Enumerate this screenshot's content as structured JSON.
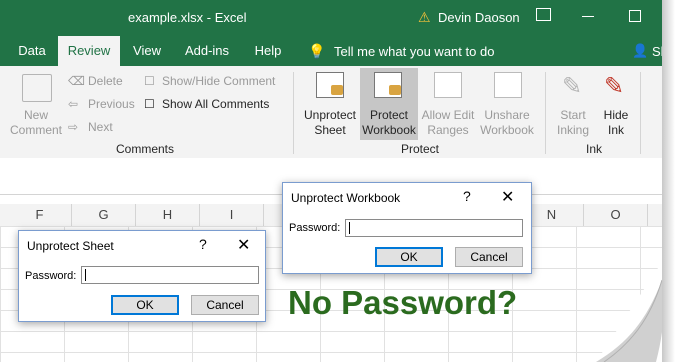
{
  "window": {
    "title": "example.xlsx  -  Excel",
    "user": "Devin Daoson",
    "colors": {
      "brand": "#217346",
      "headline": "#2b6b1f",
      "ok_border": "#0078d7"
    }
  },
  "tabs": [
    {
      "label": "Data"
    },
    {
      "label": "Review"
    },
    {
      "label": "View"
    },
    {
      "label": "Add-ins"
    },
    {
      "label": "Help"
    }
  ],
  "tell_me": "Tell me what you want to do",
  "share_label": "Sl",
  "ribbon": {
    "new_comment": {
      "line1": "New",
      "line2": "Comment"
    },
    "delete": "Delete",
    "previous": "Previous",
    "next": "Next",
    "show_hide_comment": "Show/Hide Comment",
    "show_all_comments": "Show All Comments",
    "comments_group": "Comments",
    "unprotect_sheet": {
      "line1": "Unprotect",
      "line2": "Sheet"
    },
    "protect_workbook": {
      "line1": "Protect",
      "line2": "Workbook"
    },
    "allow_edit_ranges": {
      "line1": "Allow Edit",
      "line2": "Ranges"
    },
    "unshare_workbook": {
      "line1": "Unshare",
      "line2": "Workbook"
    },
    "protect_group": "Protect",
    "start_inking": {
      "line1": "Start",
      "line2": "Inking"
    },
    "hide_ink": {
      "line1": "Hide",
      "line2": "Ink"
    },
    "ink_group": "Ink"
  },
  "columns": [
    "F",
    "G",
    "H",
    "I",
    "N",
    "O"
  ],
  "dialog_workbook": {
    "title": "Unprotect Workbook",
    "help": "?",
    "close": "✕",
    "label": "Password:",
    "value": "",
    "ok": "OK",
    "cancel": "Cancel"
  },
  "dialog_sheet": {
    "title": "Unprotect Sheet",
    "help": "?",
    "close": "✕",
    "label": "Password:",
    "value": "",
    "ok": "OK",
    "cancel": "Cancel"
  },
  "headline": "No Password?"
}
